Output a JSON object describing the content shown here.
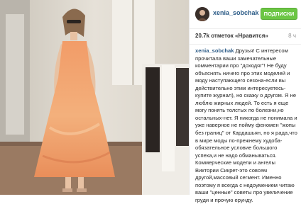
{
  "post": {
    "username": "xenia_sobchak",
    "follow_label": "ПОДПИСКИ",
    "likes": "20.7k отметок «Нравится»",
    "time": "8 ч",
    "caption_author": "xenia_sobchak",
    "caption_text": " Друзья! С интересом прочитала ваши замечательные комментарии про \"доходяг\"! Не буду объяснять ничего про этих моделей и моду наступающего сезона-если вы действительно этим интересуетесь-купите журнал), но скажу о другом. Я не люблю жирных людей. То есть я еще могу понять толстых по болезни,но остальных-нет. Я никогда не понимала и уже наверное не пойму феномен \"жопы без границ\" от Кардашьян, но я рада,что в мире моды по-прежнему худоба-обязательное условие большого успеха,и не надо обманываться. Коммерческие модели и ангелы Виктории Сикрет-это совсем другой,массовый сегмент. Именно поэтому я всегда с недоумением читаю ваши \"ценные\" советы про увеличение груди и прочую ерунду."
  },
  "colors": {
    "username": "#2a5a86",
    "follow_button": "#6cc644",
    "dress": "#f0a26d"
  }
}
